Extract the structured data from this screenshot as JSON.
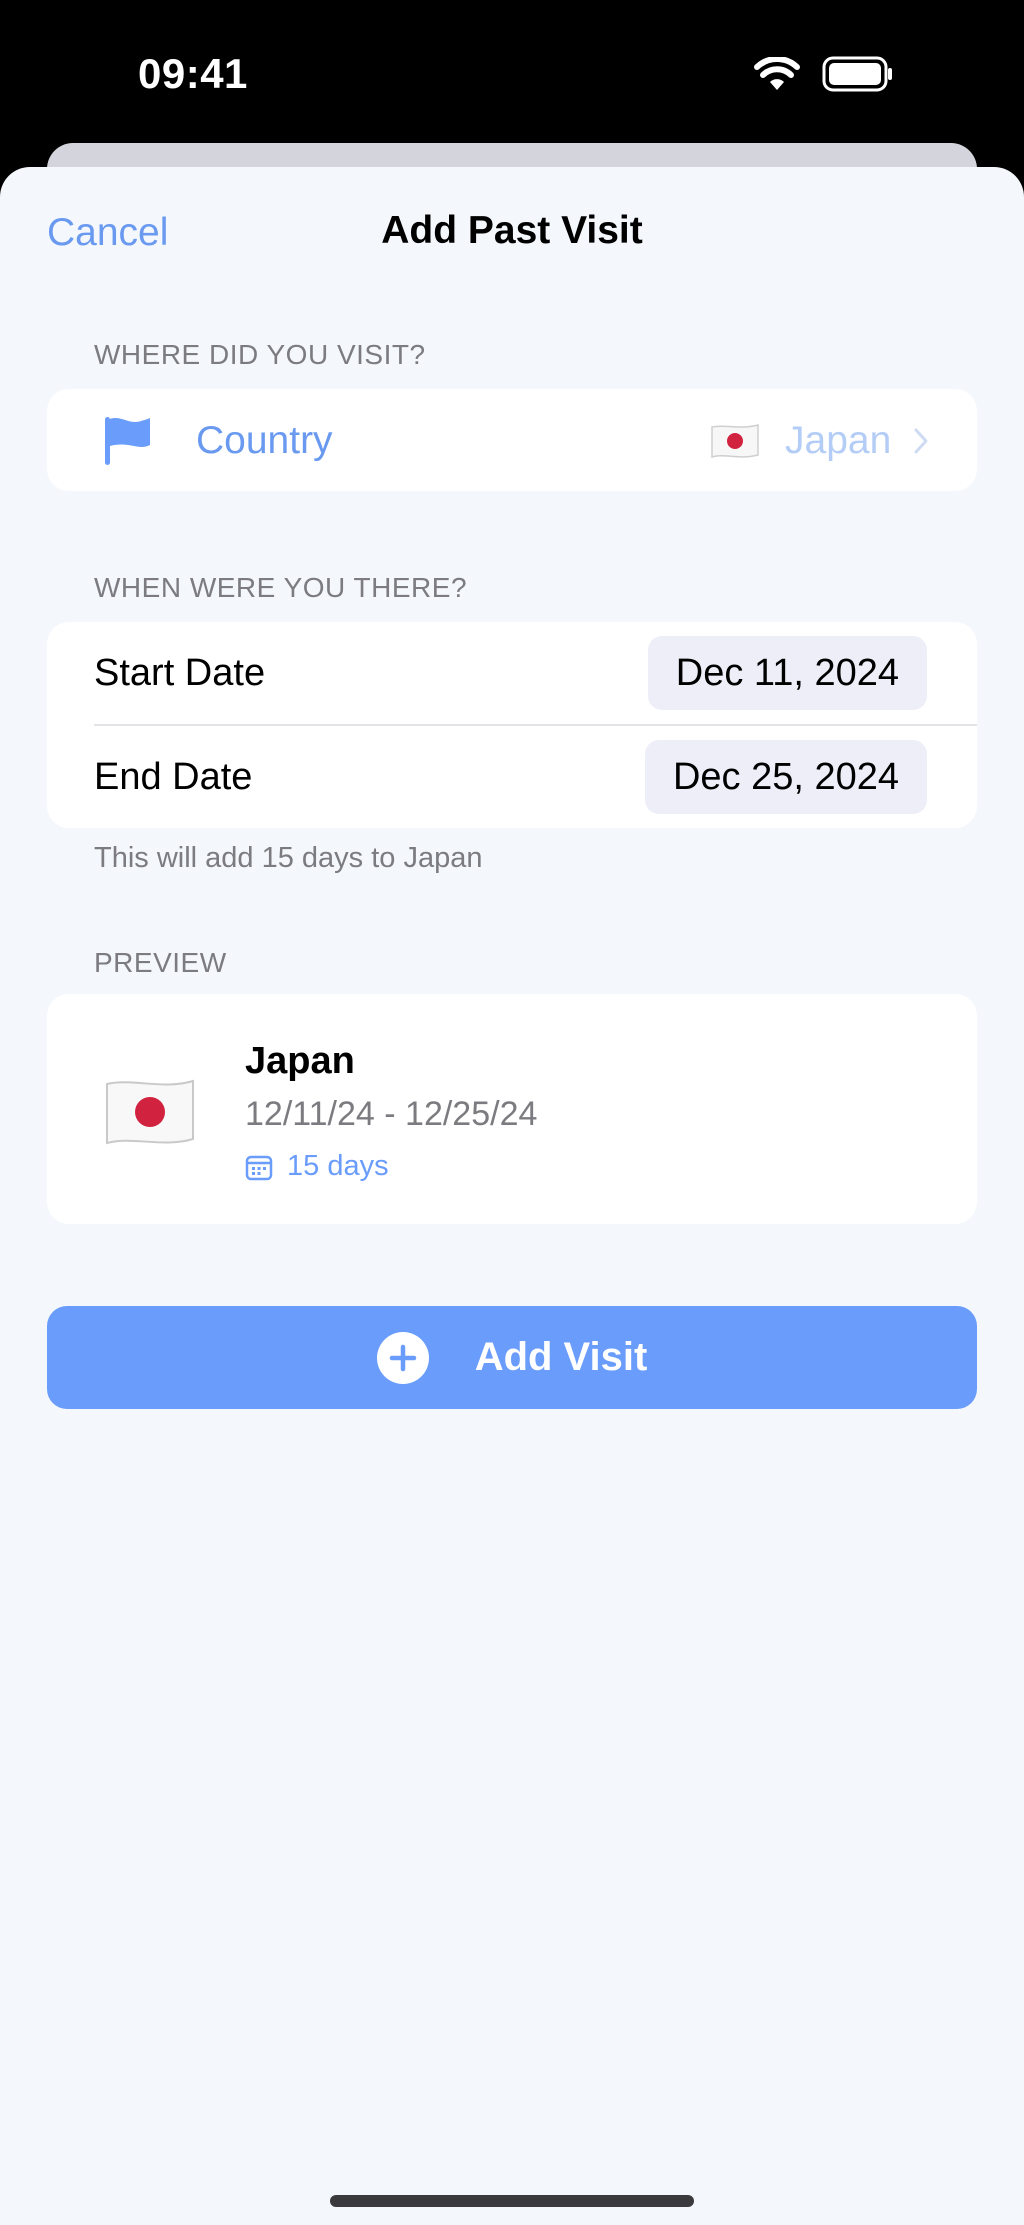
{
  "status": {
    "time": "09:41"
  },
  "nav": {
    "cancel_label": "Cancel",
    "title": "Add Past Visit"
  },
  "location": {
    "header": "WHERE DID YOU VISIT?",
    "field_label": "Country",
    "field_icon": "flag-icon",
    "selected_flag": "japan-flag-icon",
    "selected_value": "Japan"
  },
  "dates": {
    "header": "WHEN WERE YOU THERE?",
    "start_label": "Start Date",
    "start_value": "Dec 11, 2024",
    "end_label": "End Date",
    "end_value": "Dec 25, 2024",
    "footnote": "This will add 15 days to Japan"
  },
  "preview": {
    "header": "PREVIEW",
    "country": "Japan",
    "range": "12/11/24 - 12/25/24",
    "duration": "15 days"
  },
  "actions": {
    "add_label": "Add Visit"
  },
  "colors": {
    "accent": "#6a9cfb",
    "link": "#6a9af0",
    "muted_value": "#b4cdf6",
    "japan_red": "#d1233f"
  }
}
